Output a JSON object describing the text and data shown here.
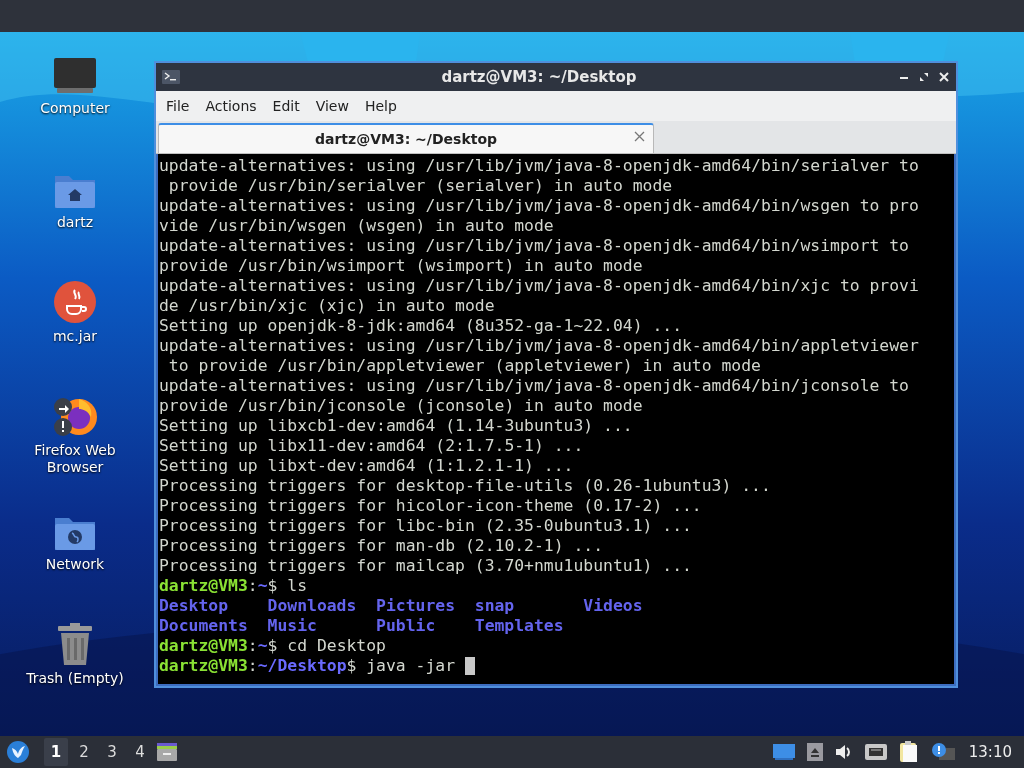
{
  "desktop": {
    "icons": [
      {
        "label": "Computer",
        "kind": "computer"
      },
      {
        "label": "dartz",
        "kind": "home"
      },
      {
        "label": "mc.jar",
        "kind": "java"
      },
      {
        "label": "Firefox Web Browser",
        "kind": "firefox"
      },
      {
        "label": "Network",
        "kind": "network"
      },
      {
        "label": "Trash (Empty)",
        "kind": "trash"
      }
    ]
  },
  "window": {
    "title": "dartz@VM3: ~/Desktop",
    "menu": [
      "File",
      "Actions",
      "Edit",
      "View",
      "Help"
    ],
    "tabs": [
      {
        "label": "dartz@VM3: ~/Desktop",
        "selected": true
      }
    ],
    "terminal": {
      "lines": [
        {
          "kind": "text",
          "segments": [
            {
              "kind": "plain",
              "text": "update-alternatives: using /usr/lib/jvm/java-8-openjdk-amd64/bin/serialver to"
            }
          ]
        },
        {
          "kind": "text",
          "segments": [
            {
              "kind": "plain",
              "text": " provide /usr/bin/serialver (serialver) in auto mode"
            }
          ]
        },
        {
          "kind": "text",
          "segments": [
            {
              "kind": "plain",
              "text": "update-alternatives: using /usr/lib/jvm/java-8-openjdk-amd64/bin/wsgen to pro"
            }
          ]
        },
        {
          "kind": "text",
          "segments": [
            {
              "kind": "plain",
              "text": "vide /usr/bin/wsgen (wsgen) in auto mode"
            }
          ]
        },
        {
          "kind": "text",
          "segments": [
            {
              "kind": "plain",
              "text": "update-alternatives: using /usr/lib/jvm/java-8-openjdk-amd64/bin/wsimport to"
            }
          ]
        },
        {
          "kind": "text",
          "segments": [
            {
              "kind": "plain",
              "text": "provide /usr/bin/wsimport (wsimport) in auto mode"
            }
          ]
        },
        {
          "kind": "text",
          "segments": [
            {
              "kind": "plain",
              "text": "update-alternatives: using /usr/lib/jvm/java-8-openjdk-amd64/bin/xjc to provi"
            }
          ]
        },
        {
          "kind": "text",
          "segments": [
            {
              "kind": "plain",
              "text": "de /usr/bin/xjc (xjc) in auto mode"
            }
          ]
        },
        {
          "kind": "text",
          "segments": [
            {
              "kind": "plain",
              "text": "Setting up openjdk-8-jdk:amd64 (8u352-ga-1~22.04) ..."
            }
          ]
        },
        {
          "kind": "text",
          "segments": [
            {
              "kind": "plain",
              "text": "update-alternatives: using /usr/lib/jvm/java-8-openjdk-amd64/bin/appletviewer"
            }
          ]
        },
        {
          "kind": "text",
          "segments": [
            {
              "kind": "plain",
              "text": " to provide /usr/bin/appletviewer (appletviewer) in auto mode"
            }
          ]
        },
        {
          "kind": "text",
          "segments": [
            {
              "kind": "plain",
              "text": "update-alternatives: using /usr/lib/jvm/java-8-openjdk-amd64/bin/jconsole to"
            }
          ]
        },
        {
          "kind": "text",
          "segments": [
            {
              "kind": "plain",
              "text": "provide /usr/bin/jconsole (jconsole) in auto mode"
            }
          ]
        },
        {
          "kind": "text",
          "segments": [
            {
              "kind": "plain",
              "text": "Setting up libxcb1-dev:amd64 (1.14-3ubuntu3) ..."
            }
          ]
        },
        {
          "kind": "text",
          "segments": [
            {
              "kind": "plain",
              "text": "Setting up libx11-dev:amd64 (2:1.7.5-1) ..."
            }
          ]
        },
        {
          "kind": "text",
          "segments": [
            {
              "kind": "plain",
              "text": "Setting up libxt-dev:amd64 (1:1.2.1-1) ..."
            }
          ]
        },
        {
          "kind": "text",
          "segments": [
            {
              "kind": "plain",
              "text": "Processing triggers for desktop-file-utils (0.26-1ubuntu3) ..."
            }
          ]
        },
        {
          "kind": "text",
          "segments": [
            {
              "kind": "plain",
              "text": "Processing triggers for hicolor-icon-theme (0.17-2) ..."
            }
          ]
        },
        {
          "kind": "text",
          "segments": [
            {
              "kind": "plain",
              "text": "Processing triggers for libc-bin (2.35-0ubuntu3.1) ..."
            }
          ]
        },
        {
          "kind": "text",
          "segments": [
            {
              "kind": "plain",
              "text": "Processing triggers for man-db (2.10.2-1) ..."
            }
          ]
        },
        {
          "kind": "text",
          "segments": [
            {
              "kind": "plain",
              "text": "Processing triggers for mailcap (3.70+nmu1ubuntu1) ..."
            }
          ]
        },
        {
          "kind": "text",
          "segments": [
            {
              "kind": "user",
              "text": "dartz@VM3"
            },
            {
              "kind": "plain",
              "text": ":"
            },
            {
              "kind": "path",
              "text": "~"
            },
            {
              "kind": "plain",
              "text": "$ ls"
            }
          ]
        },
        {
          "kind": "listing",
          "rows": [
            [
              "Desktop",
              "Downloads",
              "Pictures",
              "snap",
              "Videos"
            ],
            [
              "Documents",
              "Music",
              "Public",
              "Templates"
            ]
          ]
        },
        {
          "kind": "text",
          "segments": [
            {
              "kind": "user",
              "text": "dartz@VM3"
            },
            {
              "kind": "plain",
              "text": ":"
            },
            {
              "kind": "path",
              "text": "~"
            },
            {
              "kind": "plain",
              "text": "$ cd Desktop"
            }
          ]
        },
        {
          "kind": "text",
          "cursor": true,
          "segments": [
            {
              "kind": "user",
              "text": "dartz@VM3"
            },
            {
              "kind": "plain",
              "text": ":"
            },
            {
              "kind": "path",
              "text": "~/Desktop"
            },
            {
              "kind": "plain",
              "text": "$ java -jar "
            }
          ]
        }
      ]
    }
  },
  "taskbar": {
    "workspaces": [
      {
        "label": "1",
        "selected": true
      },
      {
        "label": "2",
        "selected": false
      },
      {
        "label": "3",
        "selected": false
      },
      {
        "label": "4",
        "selected": false
      }
    ],
    "tray": [
      {
        "kind": "screen"
      },
      {
        "kind": "eject"
      },
      {
        "kind": "volume"
      },
      {
        "kind": "network"
      },
      {
        "kind": "clipboard"
      },
      {
        "kind": "notification"
      }
    ],
    "clock": "13:10"
  }
}
